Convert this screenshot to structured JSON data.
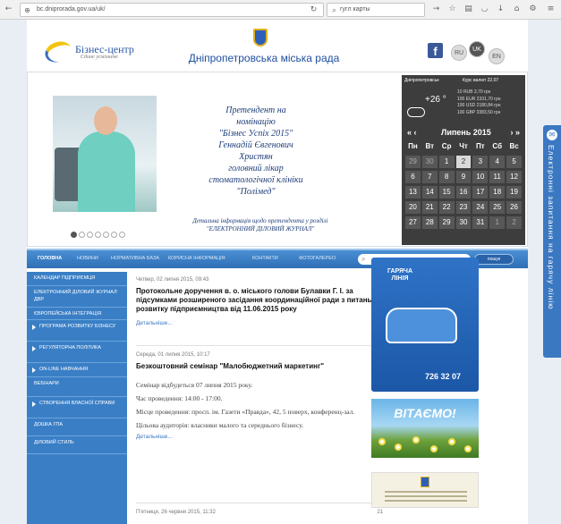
{
  "browser": {
    "url": "bc.dniprorada.gov.ua/uk/",
    "search_text": "гугл карты"
  },
  "header": {
    "logo_name": "Бізнес-центр",
    "logo_tagline": "Єдине усміхнене",
    "city_title": "Дніпропетровська міська рада",
    "languages": [
      "RU",
      "UK",
      "EN"
    ],
    "active_language": "UK"
  },
  "banner": {
    "slide_lines": [
      "Претендент на номінацію",
      "\"Бізнес Успіх 2015\"",
      "Геннадій Євгенович",
      "Христян",
      "головний лікар",
      "стоматологічної клініки",
      "\"Полімед\""
    ],
    "slide_note_1": "Детальна інформація щодо претендента у розділі",
    "slide_note_2": "\"ЕЛЕКТРОННИЙ ДІЛОВИЙ ЖУРНАЛ\"",
    "slide_count": 7,
    "active_slide": 1
  },
  "widget": {
    "city": "Дніпропетровськ",
    "rates_header": "Курс валют 22.07",
    "temperature": "+26 °",
    "rates": [
      "10 RUB 3,70 грн",
      "100 EUR 2331,70 грн",
      "100 USD 2180,84 грн",
      "100 GBP 3383,50 грн"
    ],
    "calendar": {
      "prev": "«  ‹",
      "month": "Липень 2015",
      "next": "›  »",
      "weekdays": [
        "Пн",
        "Вт",
        "Ср",
        "Чт",
        "Пт",
        "Сб",
        "Вс"
      ],
      "days": [
        "29",
        "30",
        "1",
        "2",
        "3",
        "4",
        "5",
        "6",
        "7",
        "8",
        "9",
        "10",
        "11",
        "12",
        "13",
        "14",
        "15",
        "16",
        "17",
        "18",
        "19",
        "20",
        "21",
        "22",
        "23",
        "24",
        "25",
        "26",
        "27",
        "28",
        "29",
        "30",
        "31",
        "1",
        "2"
      ],
      "today": "2"
    }
  },
  "nav": {
    "items": [
      "Головна",
      "Новини",
      "Нормативна база",
      "Корисна інформація",
      "Контакти",
      "Фотогалерео"
    ],
    "active": "Головна",
    "search_button": "пошук"
  },
  "sidebar": {
    "items": [
      {
        "label": "Календар підприємця",
        "sub": false
      },
      {
        "label": "Електронний діловий журнал ДВР",
        "sub": false
      },
      {
        "label": "Європейська інтеграція",
        "sub": false
      },
      {
        "label": "Програма розвитку бізнесу",
        "sub": true
      },
      {
        "label": "Регуляторна політика",
        "sub": true
      },
      {
        "label": "On-line навчання",
        "sub": true
      },
      {
        "label": "Вебінари",
        "sub": false
      },
      {
        "label": "Створення власної справи",
        "sub": true
      },
      {
        "label": "Дошка ГПА",
        "sub": false
      },
      {
        "label": "Діловий стиль",
        "sub": false
      }
    ]
  },
  "news": [
    {
      "date": "Четвер, 02 липня 2015, 09:43",
      "count": "2",
      "title": "Протокольне доручення в. о. міського голови Булавки Г. І. за підсумками розширеного засідання координаційної ради з питань розвитку підприємництва від 11.06.2015 року",
      "paragraphs": [],
      "more": "Детальніше..."
    },
    {
      "date": "Середа, 01 липня 2015, 10:17",
      "count": "42",
      "title": "Безкоштовний семінар \"Малобюджетний маркетинг\"",
      "paragraphs": [
        "Семінар відбудеться 07 липня 2015 року.",
        "Час проведення: 14:00 - 17:00.",
        "Місце проведення: просп. ім. Газети «Правда», 42, 5 поверх, конференц-зал.",
        "Цільова аудиторія: власники малого та середнього бізнесу."
      ],
      "more": "Детальніше..."
    },
    {
      "date": "П'ятниця, 26 червня 2015, 11:32",
      "count": "21",
      "title": "",
      "paragraphs": [],
      "more": ""
    }
  ],
  "hotline": {
    "title": "ГАРЯЧА ЛІНІЯ",
    "number": "726 32 07"
  },
  "welcome": {
    "text": "ВІТАЄМО!"
  },
  "side_tab": {
    "text": "Електронні запитання на гарячу лінію"
  },
  "colors": {
    "nav_blue": "#2f6fb6",
    "sidebar_blue": "#3a7fc6",
    "widget_bg": "#3d3d3d",
    "title_blue": "#1d4e9e"
  }
}
